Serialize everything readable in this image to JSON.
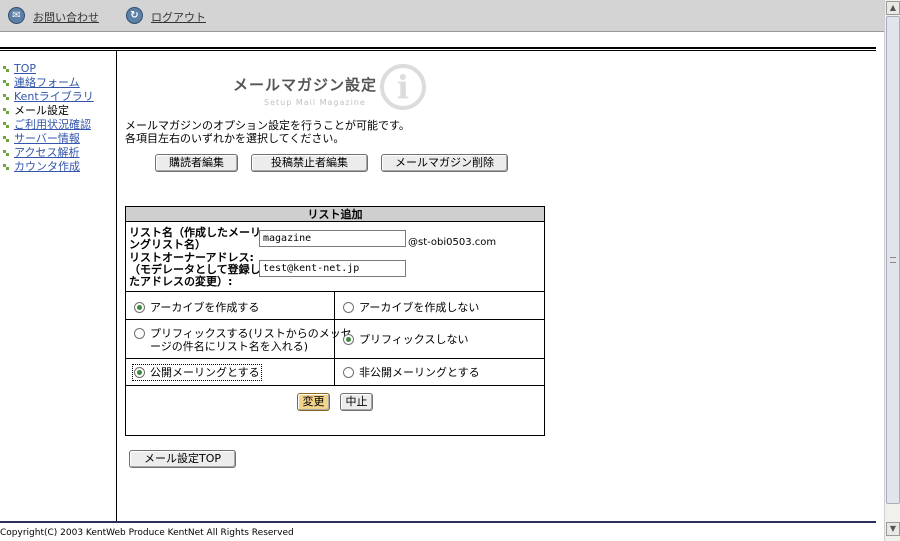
{
  "topbar": {
    "contact_link": "お問い合わせ",
    "logout_link": "ログアウト",
    "contact_icon": "mail-icon",
    "logout_icon": "logout-icon"
  },
  "sidebar": {
    "items": [
      {
        "label": "TOP",
        "link": true
      },
      {
        "label": "連絡フォーム",
        "link": true
      },
      {
        "label": "Kentライブラリ",
        "link": true
      },
      {
        "label": "メール設定",
        "link": false
      },
      {
        "label": "ご利用状況確認",
        "link": true
      },
      {
        "label": "サーバー情報",
        "link": true
      },
      {
        "label": "アクセス解析",
        "link": true
      },
      {
        "label": "カウンタ作成",
        "link": true
      }
    ]
  },
  "header": {
    "title": "メールマガジン設定",
    "subtitle": "Setup Mail Magazine",
    "icon": "info-icon"
  },
  "description": {
    "line1": "メールマガジンのオプション設定を行うことが可能です。",
    "line2": "各項目左右のいずれかを選択してください。"
  },
  "actions": {
    "subscriber_edit": "購読者編集",
    "post_ban_edit": "投稿禁止者編集",
    "delete_magazine": "メールマガジン削除"
  },
  "list_form": {
    "heading": "リスト追加",
    "list_name_label_1": "リスト名（作成したメーリ",
    "list_name_label_2": "ングリスト名）",
    "list_name_value": "magazine",
    "domain_suffix": "@st-obi0503.com",
    "owner_label_1": "リストオーナーアドレス:",
    "owner_label_2": "（モデレータとして登録し",
    "owner_label_3": "たアドレスの変更）:",
    "owner_value": "test@kent-net.jp",
    "archive_yes": "アーカイブを作成する",
    "archive_no": "アーカイブを作成しない",
    "prefix_yes_1": "プリフィックスする(リストからのメッセ",
    "prefix_yes_2": "ージの件名にリスト名を入れる)",
    "prefix_no": "プリフィックスしない",
    "public_yes": "公開メーリングとする",
    "public_no": "非公開メーリングとする",
    "selected": {
      "archive": "yes",
      "prefix": "no",
      "public": "yes"
    },
    "submit": "変更",
    "cancel": "中止"
  },
  "bottom": {
    "mail_top_button": "メール設定TOP"
  },
  "footer": {
    "copyright": "Copyright(C) 2003 KentWeb Produce KentNet All Rights Reserved"
  },
  "colors": {
    "link": "#3355aa",
    "bullet": "#6fa33b",
    "topbar": "#d4d4d4",
    "primary_button": "#f3d48b"
  }
}
